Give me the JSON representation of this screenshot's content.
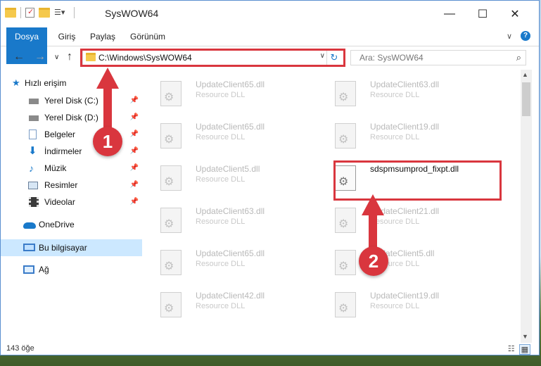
{
  "window": {
    "title": "SysWOW64",
    "minimize_glyph": "—",
    "maximize_glyph": "☐",
    "close_glyph": "✕"
  },
  "ribbon": {
    "tabs": [
      {
        "label": "Dosya",
        "active": true
      },
      {
        "label": "Giriş"
      },
      {
        "label": "Paylaş"
      },
      {
        "label": "Görünüm"
      }
    ],
    "expand_glyph": "∨",
    "help_glyph": "?"
  },
  "nav": {
    "back_glyph": "←",
    "forward_glyph": "→",
    "recent_glyph": "∨",
    "up_glyph": "↑"
  },
  "address": {
    "path": "C:\\Windows\\SysWOW64",
    "dropdown_glyph": "∨",
    "refresh_glyph": "↻"
  },
  "search": {
    "placeholder": "Ara: SysWOW64",
    "icon_glyph": "⌕"
  },
  "sidebar": {
    "items": [
      {
        "label": "Hızlı erişim",
        "icon": "star-icon",
        "pinned": false
      },
      {
        "label": "Yerel Disk (C:)",
        "icon": "drive-icon",
        "pinned": true
      },
      {
        "label": "Yerel Disk (D:)",
        "icon": "drive-icon",
        "pinned": true
      },
      {
        "label": "Belgeler",
        "icon": "documents-icon",
        "pinned": true
      },
      {
        "label": "İndirmeler",
        "icon": "download-icon",
        "pinned": true
      },
      {
        "label": "Müzik",
        "icon": "music-icon",
        "pinned": true
      },
      {
        "label": "Resimler",
        "icon": "pictures-icon",
        "pinned": true
      },
      {
        "label": "Videolar",
        "icon": "video-icon",
        "pinned": true
      },
      {
        "label": "OneDrive",
        "icon": "cloud-icon",
        "pinned": false
      },
      {
        "label": "Bu bilgisayar",
        "icon": "computer-icon",
        "pinned": false,
        "selected": true
      },
      {
        "label": "Ağ",
        "icon": "network-icon",
        "pinned": false
      }
    ],
    "pin_glyph": "📌"
  },
  "files": [
    {
      "name": "UpdateClient65.dll",
      "type": "Resource DLL"
    },
    {
      "name": "UpdateClient63.dll",
      "type": "Resource DLL"
    },
    {
      "name": "UpdateClient65.dll",
      "type": "Resource DLL"
    },
    {
      "name": "UpdateClient19.dll",
      "type": "Resource DLL"
    },
    {
      "name": "UpdateClient5.dll",
      "type": "Resource DLL"
    },
    {
      "name": "sdspmsumprod_fixpt.dll",
      "type": "",
      "highlighted": true
    },
    {
      "name": "UpdateClient63.dll",
      "type": "Resource DLL"
    },
    {
      "name": "UpdateClient21.dll",
      "type": "Resource DLL"
    },
    {
      "name": "UpdateClient65.dll",
      "type": "Resource DLL"
    },
    {
      "name": "UpdateClient5.dll",
      "type": "Resource DLL"
    },
    {
      "name": "UpdateClient42.dll",
      "type": "Resource DLL"
    },
    {
      "name": "UpdateClient19.dll",
      "type": "Resource DLL"
    }
  ],
  "status": {
    "item_count": "143 öğe"
  },
  "annotations": {
    "marker1": "1",
    "marker2": "2",
    "color": "#d9363e"
  },
  "colors": {
    "accent": "#1979ca",
    "selection": "#cce8ff"
  }
}
